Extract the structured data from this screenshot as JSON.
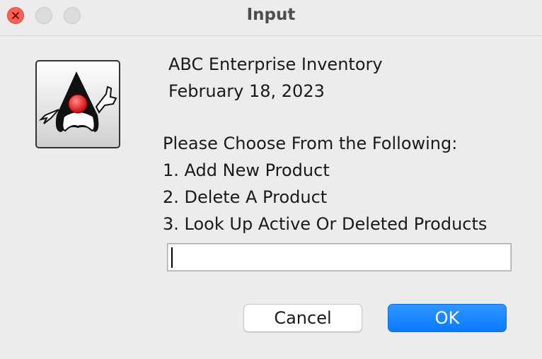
{
  "window": {
    "title": "Input"
  },
  "message": {
    "line1": "ABC Enterprise Inventory",
    "line2": "February 18, 2023",
    "line3": "Please Choose From the Following:",
    "line4": "1. Add New Product",
    "line5": "2. Delete A Product",
    "line6": "3. Look Up Active Or Deleted Products"
  },
  "input": {
    "value": "",
    "placeholder": ""
  },
  "buttons": {
    "cancel": "Cancel",
    "ok": "OK"
  },
  "icons": {
    "app": "java-duke-icon",
    "close": "close-icon"
  },
  "colors": {
    "accent": "#0a7bff",
    "close": "#fe5f57"
  }
}
